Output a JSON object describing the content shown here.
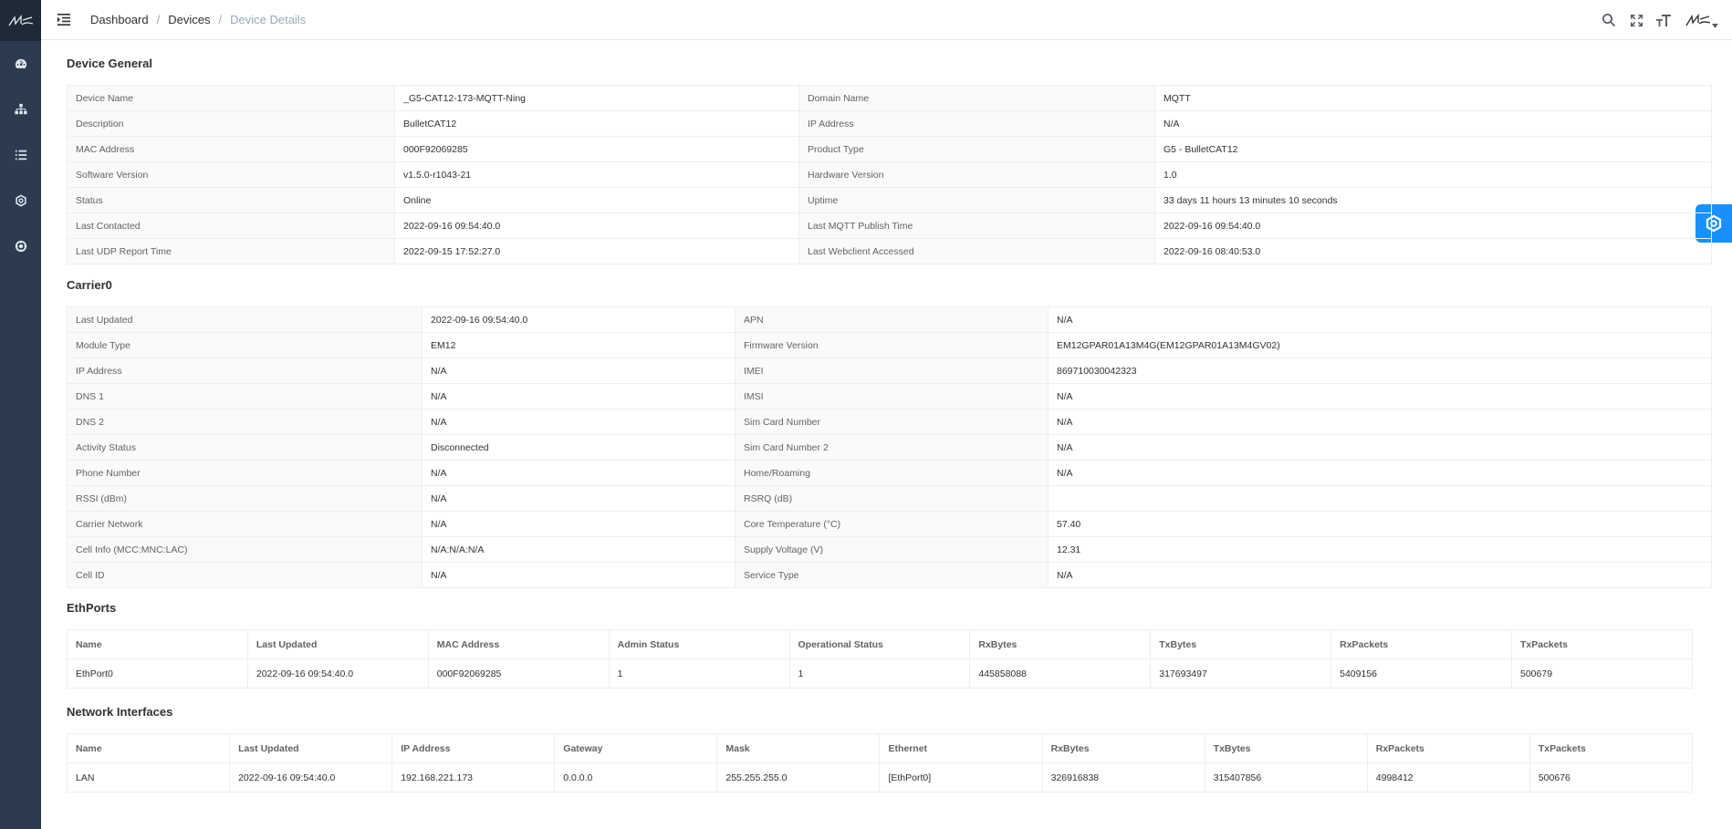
{
  "nav": {
    "items": [
      "dashboard-icon",
      "network-topology-icon",
      "list-icon",
      "settings-icon",
      "support-icon"
    ]
  },
  "header": {
    "breadcrumb": [
      "Dashboard",
      "Devices",
      "Device Details"
    ]
  },
  "colors": {
    "sidebar": "#2c3b4f",
    "accent": "#1890ff",
    "online": "#52c41a"
  },
  "general": {
    "title": "Device General",
    "rows": [
      [
        "Device Name",
        "_G5-CAT12-173-MQTT-Ning",
        "Domain Name",
        "MQTT"
      ],
      [
        "Description",
        "BulletCAT12",
        "IP Address",
        "N/A"
      ],
      [
        "MAC Address",
        "000F92069285",
        "Product Type",
        "G5 - BulletCAT12"
      ],
      [
        "Software Version",
        "v1.5.0-r1043-21",
        "Hardware Version",
        "1.0"
      ],
      [
        "Status",
        "Online",
        "Uptime",
        "33 days 11 hours 13 minutes 10 seconds"
      ],
      [
        "Last Contacted",
        "2022-09-16 09:54:40.0",
        "Last MQTT Publish Time",
        "2022-09-16 09:54:40.0"
      ],
      [
        "Last UDP Report Time",
        "2022-09-15 17:52:27.0",
        "Last Webclient Accessed",
        "2022-09-16 08:40:53.0"
      ]
    ]
  },
  "carrier": {
    "title": "Carrier0",
    "rows": [
      [
        "Last Updated",
        "2022-09-16 09:54:40.0",
        "APN",
        "N/A"
      ],
      [
        "Module Type",
        "EM12",
        "Firmware Version",
        "EM12GPAR01A13M4G(EM12GPAR01A13M4GV02)"
      ],
      [
        "IP Address",
        "N/A",
        "IMEI",
        "869710030042323"
      ],
      [
        "DNS 1",
        "N/A",
        "IMSI",
        "N/A"
      ],
      [
        "DNS 2",
        "N/A",
        "Sim Card Number",
        "N/A"
      ],
      [
        "Activity Status",
        "Disconnected",
        "Sim Card Number 2",
        "N/A"
      ],
      [
        "Phone Number",
        "N/A",
        "Home/Roaming",
        "N/A"
      ],
      [
        "RSSI (dBm)",
        "N/A",
        "RSRQ (dB)",
        ""
      ],
      [
        "Carrier Network",
        "N/A",
        "Core Temperature (°C)",
        "57.40"
      ],
      [
        "Cell Info (MCC:MNC:LAC)",
        "N/A:N/A:N/A",
        "Supply Voltage (V)",
        "12.31"
      ],
      [
        "Cell ID",
        "N/A",
        "Service Type",
        "N/A"
      ]
    ]
  },
  "ethports": {
    "title": "EthPorts",
    "columns": [
      "Name",
      "Last Updated",
      "MAC Address",
      "Admin Status",
      "Operational Status",
      "RxBytes",
      "TxBytes",
      "RxPackets",
      "TxPackets"
    ],
    "rows": [
      [
        "EthPort0",
        "2022-09-16 09:54:40.0",
        "000F92069285",
        "1",
        "1",
        "445858088",
        "317693497",
        "5409156",
        "500679"
      ]
    ]
  },
  "netif": {
    "title": "Network Interfaces",
    "columns": [
      "Name",
      "Last Updated",
      "IP Address",
      "Gateway",
      "Mask",
      "Ethernet",
      "RxBytes",
      "TxBytes",
      "RxPackets",
      "TxPackets"
    ],
    "rows": [
      [
        "LAN",
        "2022-09-16 09:54:40.0",
        "192.168.221.173",
        "0.0.0.0",
        "255.255.255.0",
        "[EthPort0]",
        "326916838",
        "315407856",
        "4998412",
        "500676"
      ]
    ]
  }
}
